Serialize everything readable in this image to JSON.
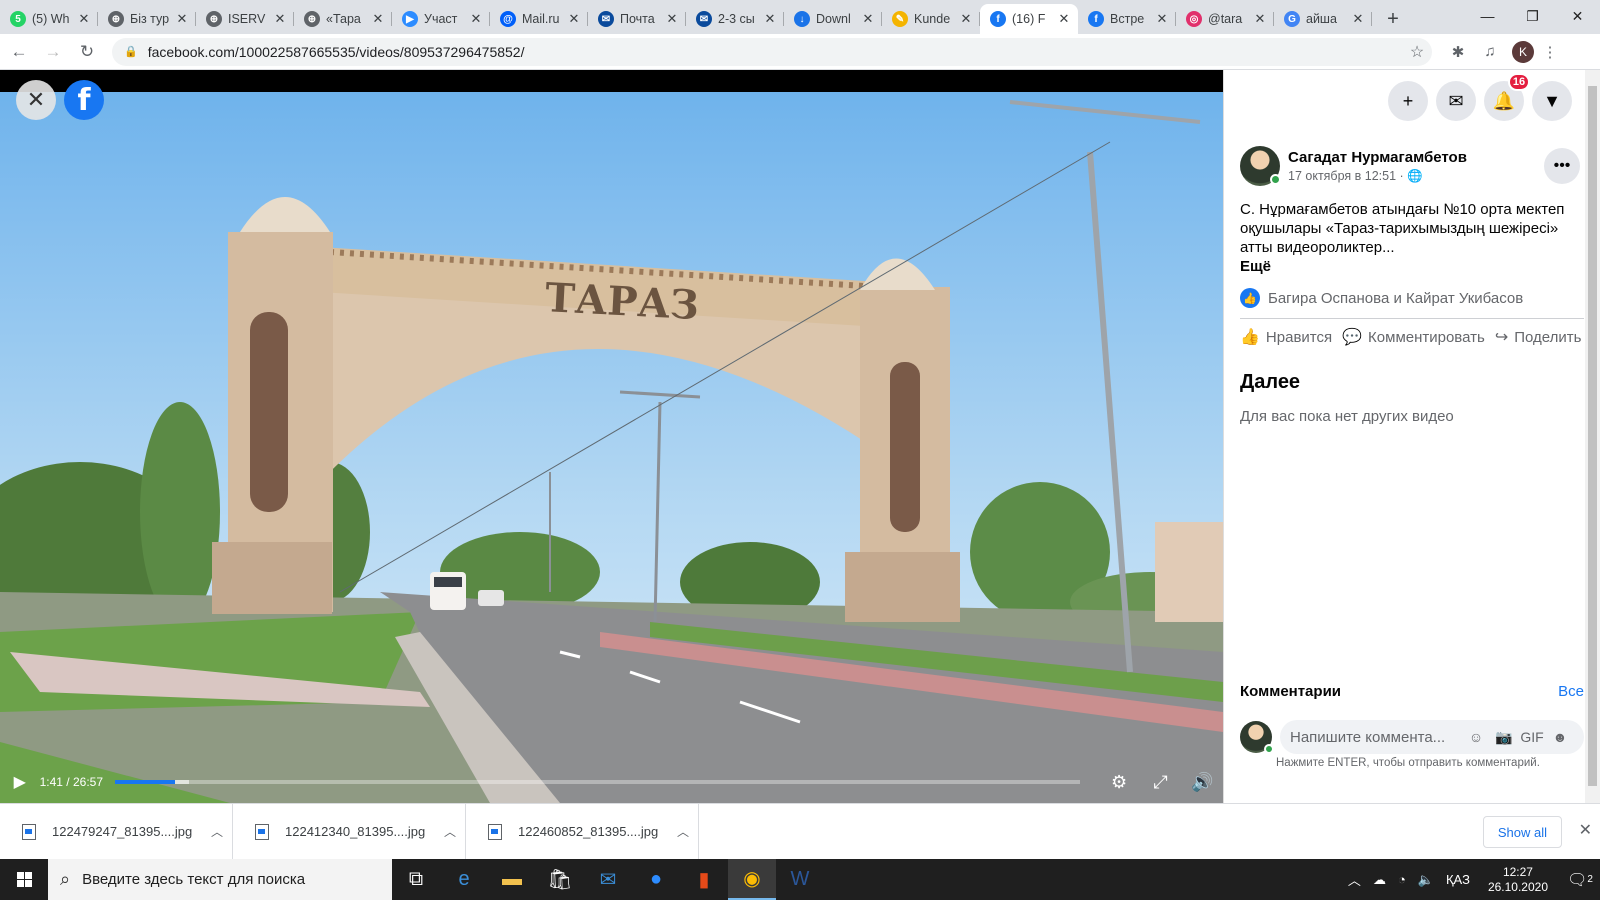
{
  "browser": {
    "tabs": [
      {
        "title": "(5) Wh",
        "fav_color": "#25d366",
        "fav_glyph": "5"
      },
      {
        "title": "Біз тур",
        "fav_color": "#5f6368",
        "fav_glyph": "⊕"
      },
      {
        "title": "ISERV",
        "fav_color": "#5f6368",
        "fav_glyph": "⊕"
      },
      {
        "title": "«Тара",
        "fav_color": "#5f6368",
        "fav_glyph": "⊕"
      },
      {
        "title": "Участ",
        "fav_color": "#2d8cff",
        "fav_glyph": "▶"
      },
      {
        "title": "Mail.ru",
        "fav_color": "#005ff9",
        "fav_glyph": "@"
      },
      {
        "title": "Почта",
        "fav_color": "#0a4a9c",
        "fav_glyph": "✉"
      },
      {
        "title": "2-3 сы",
        "fav_color": "#0a4a9c",
        "fav_glyph": "✉"
      },
      {
        "title": "Downl",
        "fav_color": "#1a73e8",
        "fav_glyph": "↓"
      },
      {
        "title": "Kunde",
        "fav_color": "#f4b400",
        "fav_glyph": "✎"
      },
      {
        "title": "(16) F",
        "fav_color": "#1877f2",
        "fav_glyph": "f",
        "active": true
      },
      {
        "title": "Встре",
        "fav_color": "#1877f2",
        "fav_glyph": "f"
      },
      {
        "title": "@tara",
        "fav_color": "#e1306c",
        "fav_glyph": "◎"
      },
      {
        "title": "айша",
        "fav_color": "#4285f4",
        "fav_glyph": "G"
      }
    ],
    "url": "facebook.com/100022587665535/videos/809537296475852/",
    "profile_initial": "K"
  },
  "video": {
    "time": "1:41 / 26:57",
    "progress": 0.062,
    "buffer": 0.077,
    "sign_text": "ТАРАЗ"
  },
  "sidebar": {
    "notifications_count": "16",
    "author_name": "Сагадат Нурмагамбетов",
    "post_date": "17 октября в 12:51 · ",
    "post_text": "С. Нұрмағамбетов атындағы №10 орта мектеп оқушылары «Тараз-тарихымыздың шежіресі» атты видеороликтер...",
    "more_label": "Ещё",
    "reactions_text": "Багира Оспанова и Кайрат Укибасов",
    "actions": {
      "like": "Нравится",
      "comment": "Комментировать",
      "share": "Поделить"
    },
    "next_title": "Далее",
    "next_empty": "Для вас пока нет других видео",
    "comments_label": "Комментарии",
    "comments_all": "Все",
    "comment_placeholder": "Напишите коммента...",
    "comment_hint": "Нажмите ENTER, чтобы отправить комментарий."
  },
  "downloads": {
    "items": [
      "122479247_81395....jpg",
      "122412340_81395....jpg",
      "122460852_81395....jpg"
    ],
    "show_all": "Show all"
  },
  "taskbar": {
    "search_placeholder": "Введите здесь текст для поиска",
    "lang": "ҚАЗ",
    "time": "12:27",
    "date": "26.10.2020",
    "notif_count": "2"
  }
}
